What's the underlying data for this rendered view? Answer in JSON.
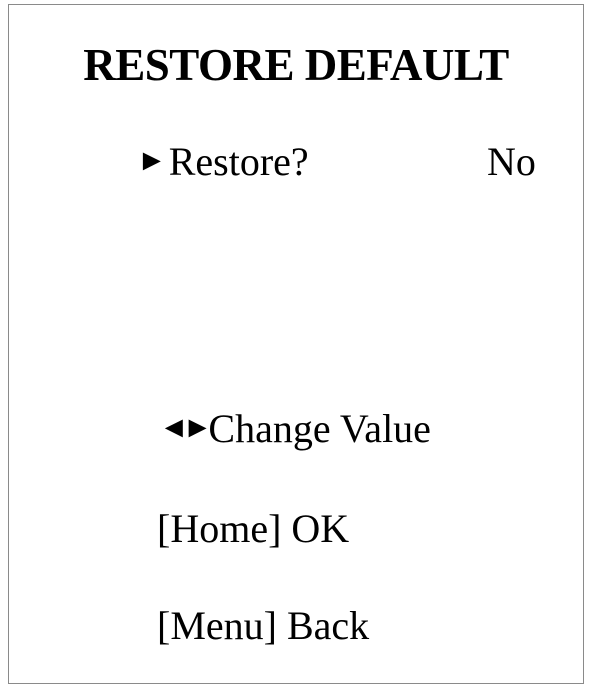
{
  "menu": {
    "title": "RESTORE DEFAULT",
    "item": {
      "pointer": "►",
      "label": "Restore?",
      "value": "No"
    }
  },
  "hints": {
    "change_arrows": "◄►",
    "change_value": "Change Value",
    "ok": "[Home] OK",
    "back": "[Menu] Back"
  }
}
